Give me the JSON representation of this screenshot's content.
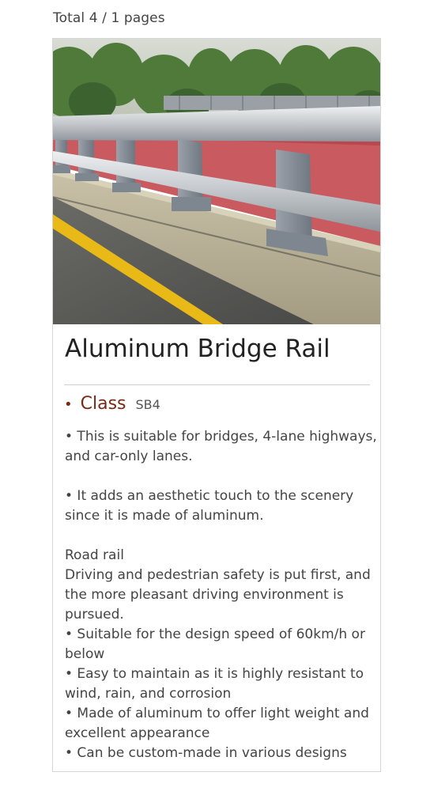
{
  "pagination": {
    "total_text": "Total 4 / 1 pages"
  },
  "product": {
    "image_alt": "aluminum bridge rail photo",
    "title": "Aluminum Bridge Rail",
    "class_label": "Class",
    "class_value": "SB4",
    "description": {
      "para1": [
        "• This is suitable for bridges, 4-lane highways,",
        "and car-only lanes."
      ],
      "para2": [
        "• It adds an aesthetic touch to the scenery",
        "since it is made of aluminum."
      ],
      "para3": [
        "Road rail",
        "Driving and pedestrian safety is put first, and",
        "the more pleasant driving environment is",
        "pursued.",
        "• Suitable for the design speed of 60km/h or",
        "below",
        "• Easy to maintain as it is highly resistant to",
        "wind, rain, and corrosion",
        "• Made of aluminum to offer light weight and",
        "excellent appearance",
        "• Can be custom-made in various designs"
      ]
    }
  },
  "colors": {
    "accent": "#7a2a14",
    "text": "#444444",
    "border": "#d6d6d6"
  }
}
